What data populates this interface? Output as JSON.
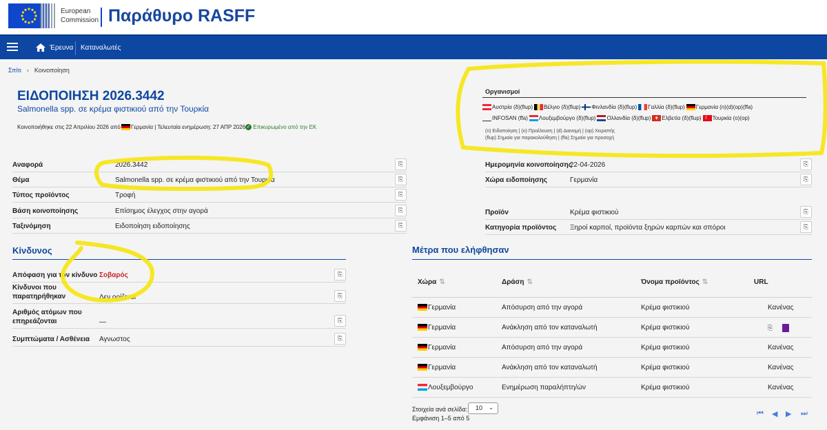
{
  "header": {
    "ec_line1": "European",
    "ec_line2": "Commission",
    "app_title": "Παράθυρο RASFF"
  },
  "nav": {
    "items": [
      "Έρευνα",
      "Καταναλωτές"
    ]
  },
  "breadcrumb": {
    "home": "Σπίτι",
    "current": "Κοινοποίηση"
  },
  "notification": {
    "title": "ΕΙΔΟΠΟΙΗΣΗ 2026.3442",
    "subtitle": "Salmonella spp. σε κρέμα φιστικιού από την Τουρκία",
    "meta_prefix": "Κοινοποιήθηκε στις 22 Απριλίου 2026 από",
    "meta_country": "Γερμανία",
    "meta_update": "| Τελευταία ενημέρωση: 27 ΑΠΡ 2026",
    "meta_verified": "Επικυρωμένο από την ΕΚ"
  },
  "organizations": {
    "title": "Οργανισμοί",
    "items": [
      {
        "name": "Αυστρία (δ)(flup)",
        "flag": "at"
      },
      {
        "name": "Βέλγιο (δ)(flup)",
        "flag": "be"
      },
      {
        "name": "Φινλανδία (δ)(flup)",
        "flag": "fi"
      },
      {
        "name": "Γαλλία (δ)(flup)",
        "flag": "fr"
      },
      {
        "name": "Γερμανία (n)(d)(op)(ffa)",
        "flag": "de"
      },
      {
        "name": "INFOSAN (ffa)",
        "flag": "none"
      },
      {
        "name": "Λουξεμβούργο (δ)(flup)",
        "flag": "lu"
      },
      {
        "name": "Ολλανδία (δ)(flup)",
        "flag": "nl"
      },
      {
        "name": "Ελβετία (δ)(flup)",
        "flag": "ch"
      },
      {
        "name": "Τουρκία (o)(op)",
        "flag": "tr"
      }
    ],
    "legend_line1": "(n) Ειδοποίηση | (ο) Προέλευση | (d) Διανομή | (op) Χειριστής",
    "legend_line2": "(flup) Σημαία για παρακολούθηση | (ffa) Σημαία για προσοχή"
  },
  "details_left": [
    {
      "label": "Αναφορά",
      "value": "2026.3442"
    },
    {
      "label": "Θέμα",
      "value": "Salmonella spp. σε κρέμα φιστικιού από την Τουρκία"
    },
    {
      "label": "Τύπος προϊόντος",
      "value": "Τροφή"
    },
    {
      "label": "Βάση κοινοποίησης",
      "value": "Επίσημος έλεγχος στην αγορά"
    },
    {
      "label": "Ταξινόμηση",
      "value": "Ειδοποίηση ειδοποίησης"
    }
  ],
  "details_right": [
    {
      "label": "Ημερομηνία κοινοποίησης",
      "value": "22-04-2026"
    },
    {
      "label": "Χώρα ειδοποίησης",
      "value": "Γερμανία"
    },
    {
      "label": "Προϊόν",
      "value": "Κρέμα φιστικιού"
    },
    {
      "label": "Κατηγορία προϊόντος",
      "value": "Ξηροί καρποί, προϊόντα ξηρών καρπών και σπόροι"
    }
  ],
  "hazard": {
    "title": "Κίνδυνος",
    "rows": [
      {
        "label": "Απόφαση για τον κίνδυνο",
        "value": "Σοβαρός"
      },
      {
        "label1": "Κίνδυνοι που",
        "label2": "παρατηρήθηκαν",
        "value": "Δεν ορίζεται"
      },
      {
        "label1": "Αριθμός ατόμων που",
        "label2": "επηρεάζονται",
        "value": "—"
      },
      {
        "label": "Συμπτώματα / Ασθένεια",
        "value": "Αγνωστος"
      }
    ]
  },
  "measures": {
    "title": "Μέτρα που ελήφθησαν",
    "columns": [
      "Χώρα",
      "Δράση",
      "Όνομα προϊόντος",
      "URL"
    ],
    "rows": [
      {
        "country": "Γερμανία",
        "flag": "de",
        "action": "Απόσυρση από την αγορά",
        "product": "Κρέμα φιστικιού",
        "url": "Κανένας"
      },
      {
        "country": "Γερμανία",
        "flag": "de",
        "action": "Ανάκληση από τον καταναλωτή",
        "product": "Κρέμα φιστικιού",
        "url": ""
      },
      {
        "country": "Γερμανία",
        "flag": "de",
        "action": "Απόσυρση από την αγορά",
        "product": "Κρέμα φιστικιού",
        "url": "Κανένας"
      },
      {
        "country": "Γερμανία",
        "flag": "de",
        "action": "Ανάκληση από τον καταναλωτή",
        "product": "Κρέμα φιστικιού",
        "url": "Κανένας"
      },
      {
        "country": "Λουξεμβούργο",
        "flag": "lu",
        "action": "Ενημέρωση παραλήπτη/ών",
        "product": "Κρέμα φιστικιού",
        "url": "Κανένας"
      }
    ],
    "per_page_label": "Στοιχεία ανά σελίδα:",
    "per_page_value": "10",
    "showing": "Εμφάνιση 1–5 από 5"
  },
  "colors": {
    "brand_blue": "#0e47a1",
    "highlight": "#f5e61a",
    "serious_red": "#c62828"
  }
}
